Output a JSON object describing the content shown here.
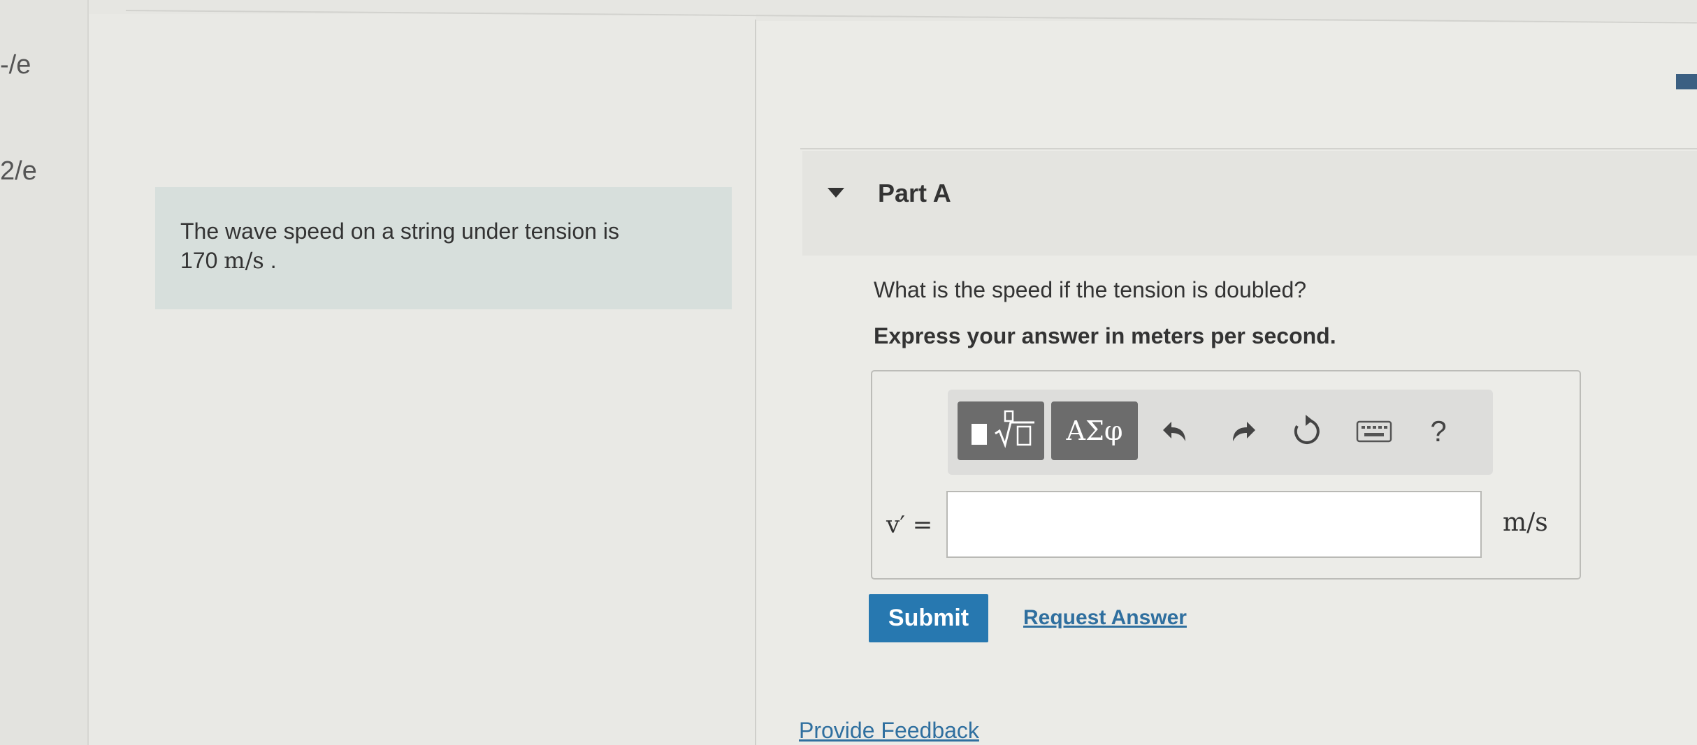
{
  "sidebar": {
    "label_top": "-/e",
    "label_bottom": "2/e"
  },
  "intro": {
    "line1": "The wave speed on a string under tension is",
    "value": "170",
    "unit": "m/s",
    "suffix": "."
  },
  "part": {
    "title": "Part A",
    "question": "What is the speed if the tension is doubled?",
    "instruction": "Express your answer in meters per second."
  },
  "toolbar": {
    "greek_label": "ΑΣφ",
    "help_label": "?",
    "icons": [
      "template-icon",
      "undo-icon",
      "redo-icon",
      "reset-icon",
      "keyboard-icon",
      "help-icon"
    ]
  },
  "answer": {
    "variable": "v′ =",
    "value": "",
    "unit": "m/s"
  },
  "actions": {
    "submit_label": "Submit",
    "request_answer_label": "Request Answer",
    "feedback_label": "Provide Feedback"
  },
  "colors": {
    "submit": "#2778b0",
    "link": "#2f6f9f",
    "intro_bg": "#d7dfdc",
    "toolbar_button": "#6c6c6c"
  }
}
